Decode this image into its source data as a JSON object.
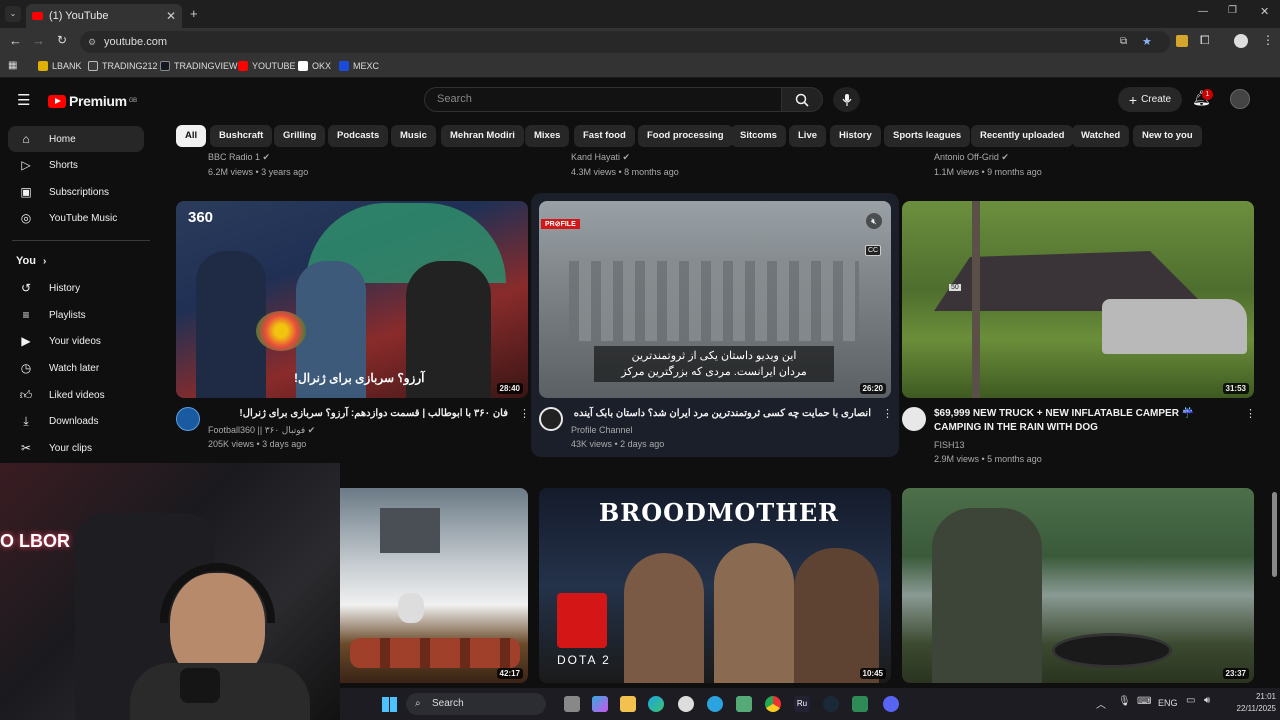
{
  "browser": {
    "tab_title": "(1) YouTube",
    "url": "youtube.com",
    "bookmarks": [
      "LBANK",
      "TRADING212",
      "TRADINGVIEW",
      "YOUTUBE",
      "OKX",
      "MEXC"
    ]
  },
  "header": {
    "logo_text": "Premium",
    "logo_country": "GB",
    "search_placeholder": "Search",
    "create_label": "Create",
    "notification_count": "1"
  },
  "sidebar": {
    "main": [
      {
        "label": "Home",
        "icon": "home-icon"
      },
      {
        "label": "Shorts",
        "icon": "shorts-icon"
      },
      {
        "label": "Subscriptions",
        "icon": "subscriptions-icon"
      },
      {
        "label": "YouTube Music",
        "icon": "music-icon"
      }
    ],
    "you_heading": "You",
    "you": [
      {
        "label": "History",
        "icon": "history-icon"
      },
      {
        "label": "Playlists",
        "icon": "playlists-icon"
      },
      {
        "label": "Your videos",
        "icon": "your-videos-icon"
      },
      {
        "label": "Watch later",
        "icon": "watch-later-icon"
      },
      {
        "label": "Liked videos",
        "icon": "liked-icon"
      },
      {
        "label": "Downloads",
        "icon": "downloads-icon"
      },
      {
        "label": "Your clips",
        "icon": "clips-icon"
      }
    ]
  },
  "chips": [
    "All",
    "Bushcraft",
    "Grilling",
    "Podcasts",
    "Music",
    "Mehran Modiri",
    "Mixes",
    "Fast food",
    "Food processing",
    "Sitcoms",
    "Live",
    "History",
    "Sports leagues",
    "Recently uploaded",
    "Watched",
    "New to you"
  ],
  "top_row": [
    {
      "channel": "BBC Radio 1",
      "meta": "6.2M views • 3 years ago"
    },
    {
      "channel": "Kand Hayati",
      "meta": "4.3M views • 8 months ago"
    },
    {
      "channel": "Antonio Off-Grid",
      "meta": "1.1M views • 9 months ago"
    }
  ],
  "videos": [
    {
      "title": "فان ۳۶۰ با ابوطالب | قسمت دوازدهم: آرزو؟ سربازی برای ژنرال!",
      "channel": "Football360 || فوتبال ۳۶۰",
      "meta": "205K views • 3 days ago",
      "duration": "28:40",
      "thumb_caption": "آرزو؟ سربازی برای ژنرال!",
      "thumb_logo": "360"
    },
    {
      "title": "انصاری با حمایت چه کسی ثروتمندترین مرد ایران شد؟ داستان بابک آینده",
      "channel": "Profile Channel",
      "meta": "43K views • 2 days ago",
      "duration": "26:20",
      "thumb_caption_1": "این ویدیو داستان یکی از ثروتمندترین",
      "thumb_caption_2": "مردان ایرانست. مردی که بزرگترین مرکز",
      "thumb_tag": "PR⊘FILE",
      "cc": "CC"
    },
    {
      "title": "$69,999 NEW TRUCK + NEW INFLATABLE CAMPER ☔ CAMPING IN THE RAIN WITH DOG",
      "channel": "FISH13",
      "meta": "2.9M views • 5 months ago",
      "duration": "31:53",
      "sign": "50"
    }
  ],
  "bottom_row": [
    {
      "duration": "42:17"
    },
    {
      "duration": "10:45",
      "title_art": "BROODMOTHER",
      "game_text": "DOTA 2"
    },
    {
      "duration": "23:37"
    }
  ],
  "webcam": {
    "sign_text": "O LBOR"
  },
  "taskbar": {
    "search_label": "Search",
    "lang": "ENG",
    "time": "21:01",
    "date": "22/11/2025"
  },
  "colors": {
    "yt_red": "#ff0000",
    "bg": "#0f0f0f",
    "chip": "#272727"
  }
}
